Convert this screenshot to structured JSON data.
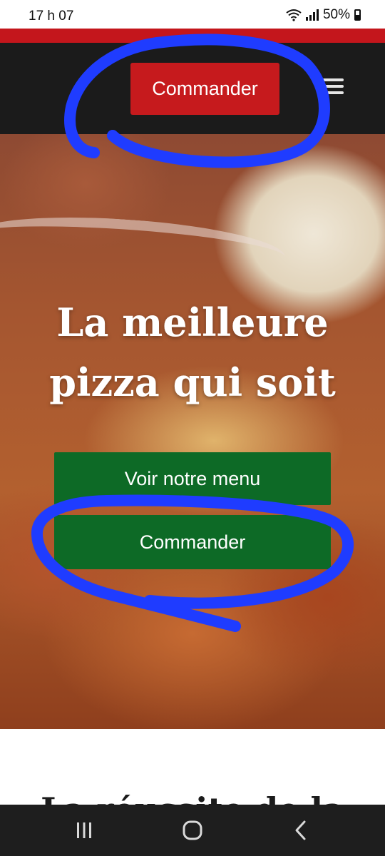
{
  "status_bar": {
    "time": "17 h 07",
    "battery": "50%"
  },
  "header": {
    "order_label": "Commander",
    "menu_icon": "hamburger-icon"
  },
  "hero": {
    "title": "La meilleure pizza qui soit",
    "menu_button_label": "Voir notre menu",
    "order_button_label": "Commander"
  },
  "next_section": {
    "title_partial": "La réussite de la"
  },
  "nav_bar": {
    "recent_icon": "recent-apps-icon",
    "home_icon": "home-icon",
    "back_icon": "back-icon"
  },
  "colors": {
    "header_bg": "#1b1b1b",
    "brand_red": "#c61a1d",
    "cta_green": "#0d6a26",
    "annotation_blue": "#1f3cff"
  }
}
